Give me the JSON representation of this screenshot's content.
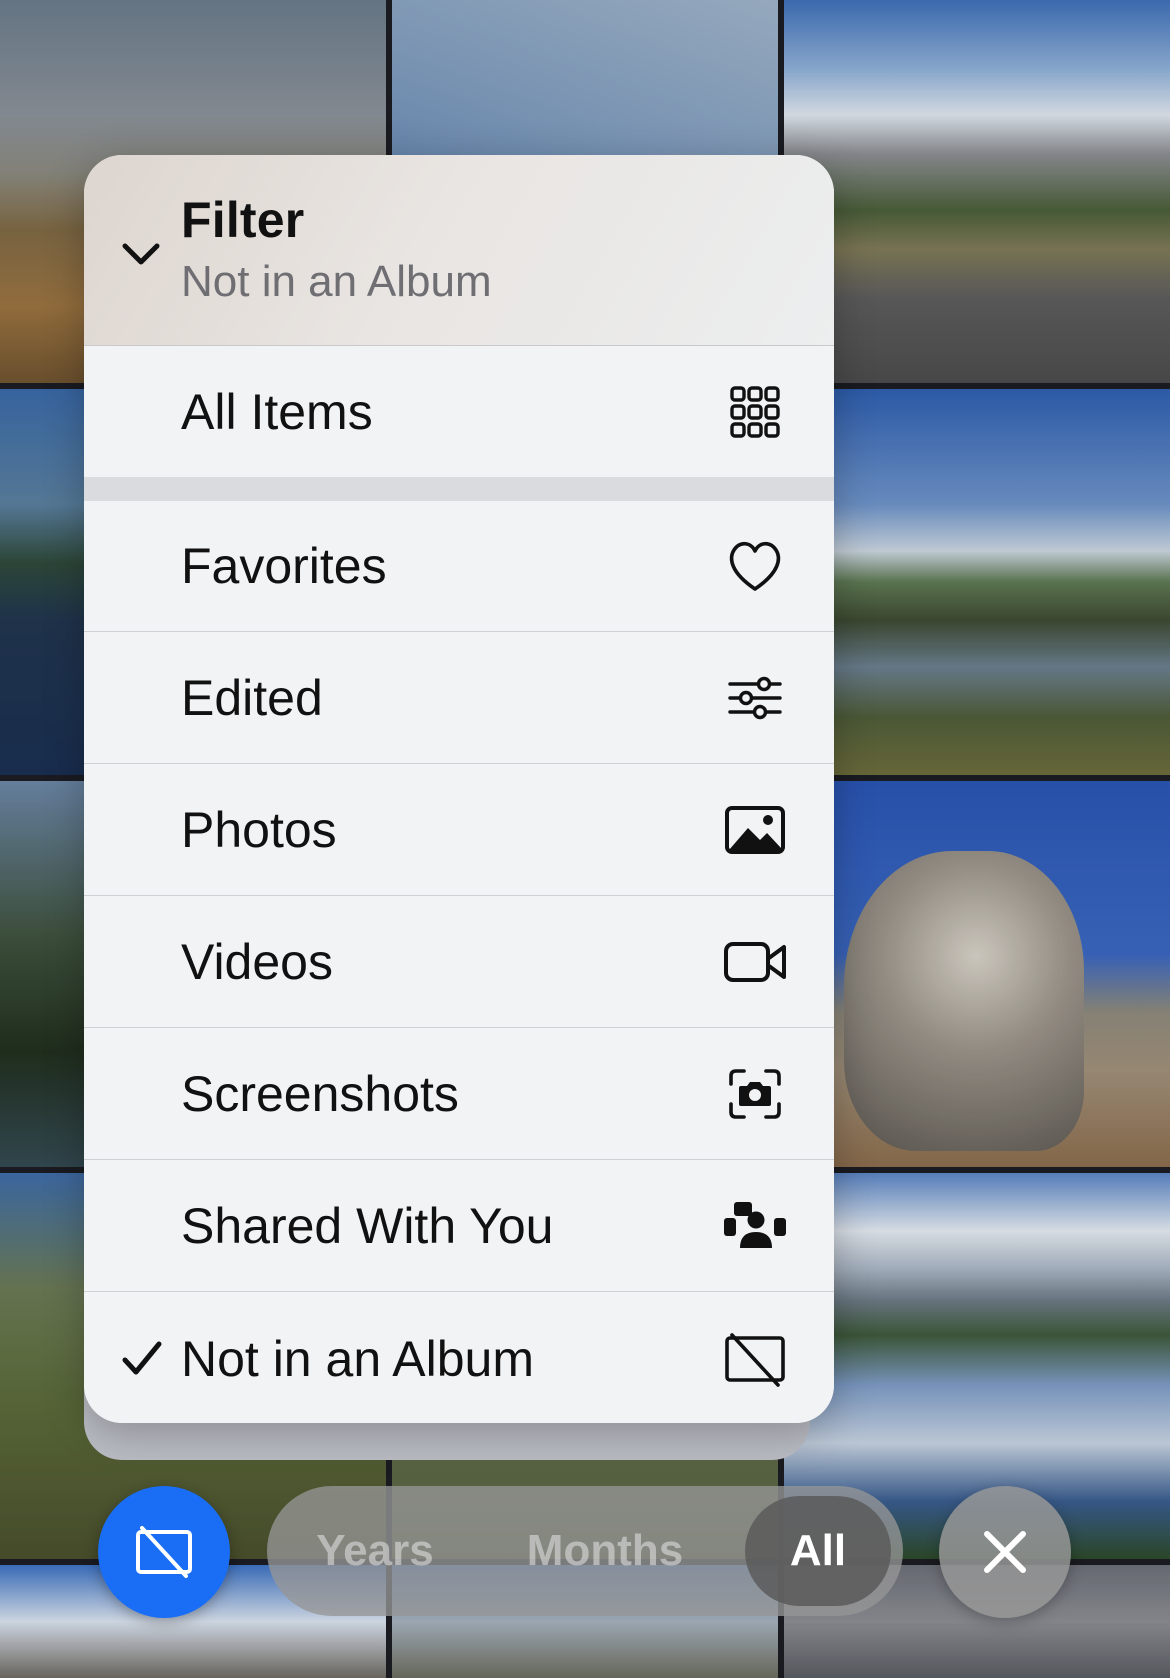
{
  "filter_menu": {
    "title": "Filter",
    "subtitle": "Not in an Album",
    "items": [
      {
        "label": "All Items",
        "icon": "grid-icon"
      },
      {
        "label": "Favorites",
        "icon": "heart-icon"
      },
      {
        "label": "Edited",
        "icon": "sliders-icon"
      },
      {
        "label": "Photos",
        "icon": "photo-icon"
      },
      {
        "label": "Videos",
        "icon": "video-camera-icon"
      },
      {
        "label": "Screenshots",
        "icon": "screenshot-camera-icon"
      },
      {
        "label": "Shared With You",
        "icon": "shared-people-icon"
      },
      {
        "label": "Not in an Album",
        "icon": "not-in-album-icon",
        "selected": true
      }
    ]
  },
  "bottom_bar": {
    "filter_button_icon": "not-in-album-icon",
    "segments": [
      "Years",
      "Months",
      "All"
    ],
    "selected_segment": "All",
    "close_icon": "close-icon"
  },
  "colors": {
    "accent_blue": "#1a6ef5",
    "menu_background": "#f2f3f5",
    "subtitle_gray": "#6e6e73"
  }
}
